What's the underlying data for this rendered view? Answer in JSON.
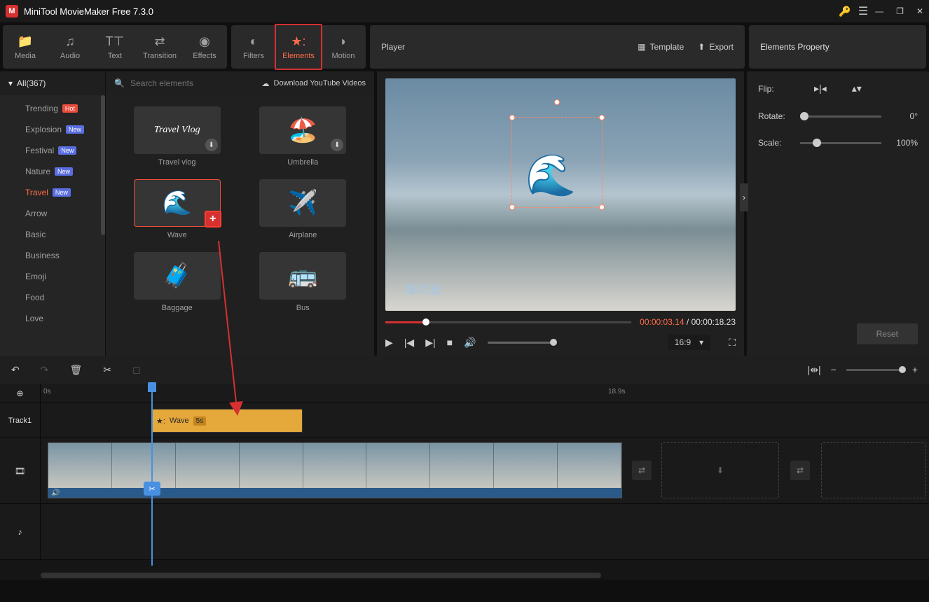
{
  "app": {
    "title": "MiniTool MovieMaker Free 7.3.0"
  },
  "tabs": {
    "media": "Media",
    "audio": "Audio",
    "text": "Text",
    "transition": "Transition",
    "effects": "Effects",
    "filters": "Filters",
    "elements": "Elements",
    "motion": "Motion"
  },
  "player_header": {
    "title": "Player",
    "template": "Template",
    "export": "Export"
  },
  "props_header": {
    "title": "Elements Property"
  },
  "categories": {
    "all_label": "All(367)",
    "items": [
      {
        "label": "Trending",
        "badge": "Hot",
        "badgeCls": "hot"
      },
      {
        "label": "Explosion",
        "badge": "New",
        "badgeCls": "new"
      },
      {
        "label": "Festival",
        "badge": "New",
        "badgeCls": "new"
      },
      {
        "label": "Nature",
        "badge": "New",
        "badgeCls": "new"
      },
      {
        "label": "Travel",
        "badge": "New",
        "badgeCls": "new",
        "active": true
      },
      {
        "label": "Arrow"
      },
      {
        "label": "Basic"
      },
      {
        "label": "Business"
      },
      {
        "label": "Emoji"
      },
      {
        "label": "Food"
      },
      {
        "label": "Love"
      }
    ]
  },
  "elements_search": {
    "placeholder": "Search elements",
    "dl_yt": "Download YouTube Videos"
  },
  "elements": [
    {
      "label": "Travel vlog",
      "glyph": "Travel Vlog",
      "text": true,
      "dl": true
    },
    {
      "label": "Umbrella",
      "glyph": "🏖️",
      "dl": true
    },
    {
      "label": "Wave",
      "glyph": "🌊",
      "selected": true,
      "add": true
    },
    {
      "label": "Airplane",
      "glyph": "✈️"
    },
    {
      "label": "Baggage",
      "glyph": "🧳"
    },
    {
      "label": "Bus",
      "glyph": "🚌"
    }
  ],
  "preview": {
    "overlay_text": "海の波",
    "time_current": "00:00:03.14",
    "time_total": "00:00:18.23",
    "aspect": "16:9"
  },
  "props": {
    "flip_label": "Flip:",
    "rotate_label": "Rotate:",
    "rotate_val": "0°",
    "scale_label": "Scale:",
    "scale_val": "100%",
    "reset": "Reset"
  },
  "timeline": {
    "ruler_start": "0s",
    "ruler_end": "18.9s",
    "track1_label": "Track1",
    "clip_name": "Wave",
    "clip_duration": "5s"
  }
}
